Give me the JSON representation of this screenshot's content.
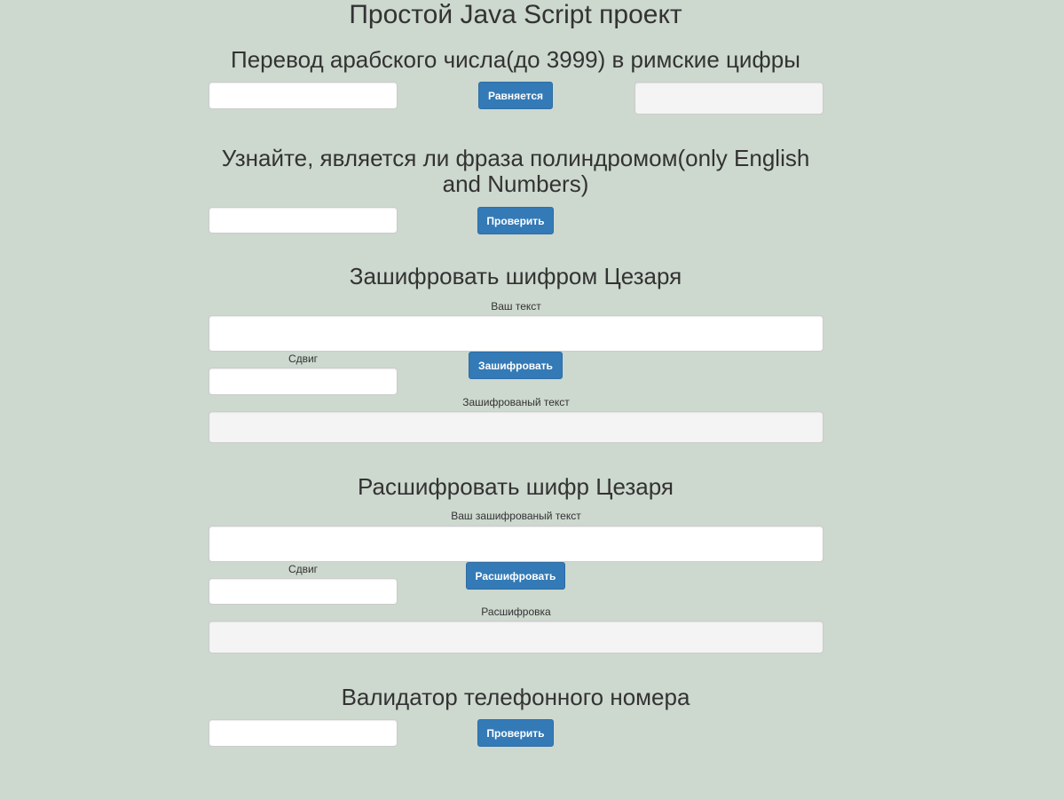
{
  "page": {
    "title": "Простой Java Script проект",
    "background_color": "#cdd8ce",
    "accent_color": "#337ab7"
  },
  "roman": {
    "heading": "Перевод арабского числа(до 3999) в римские цифры",
    "input_value": "",
    "button_label": "Равняется",
    "output_value": ""
  },
  "palindrome": {
    "heading_line1": "Узнайте, является ли фраза полиндромом(only English",
    "heading_line2": "and Numbers)",
    "input_value": "",
    "button_label": "Проверить"
  },
  "caesar_encrypt": {
    "heading": "Зашифровать шифром Цезаря",
    "text_label": "Ваш текст",
    "text_value": "",
    "shift_label": "Сдвиг",
    "shift_value": "",
    "button_label": "Зашифровать",
    "result_label": "Зашифрованый текст",
    "result_value": ""
  },
  "caesar_decrypt": {
    "heading": "Расшифровать шифр Цезаря",
    "text_label": "Ваш зашифрованый текст",
    "text_value": "",
    "shift_label": "Сдвиг",
    "shift_value": "",
    "button_label": "Расшифровать",
    "result_label": "Расшифровка",
    "result_value": ""
  },
  "phone": {
    "heading": "Валидатор телефонного номера",
    "input_value": "",
    "button_label": "Проверить"
  }
}
